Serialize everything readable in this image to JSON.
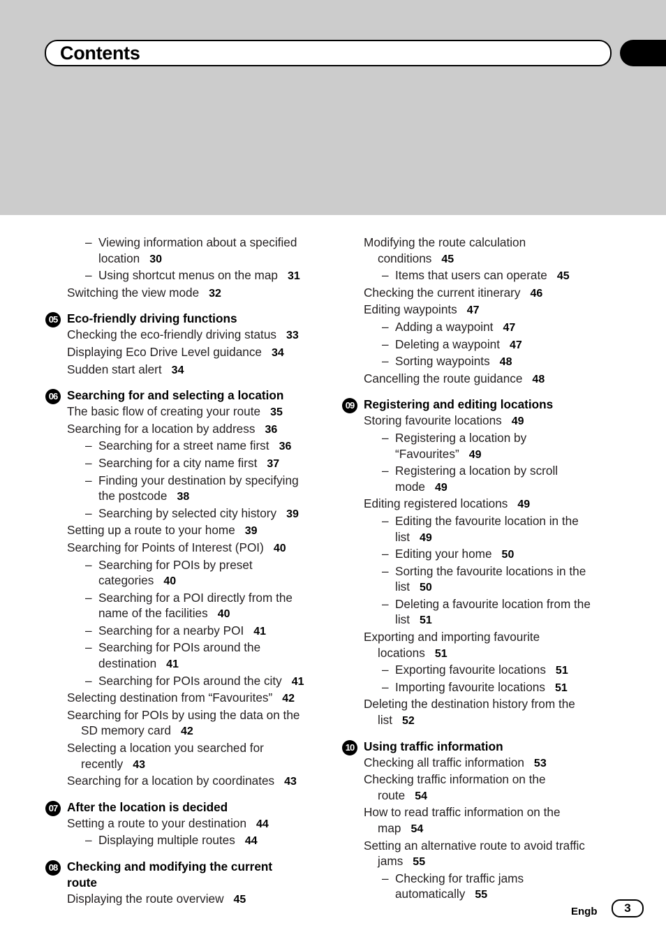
{
  "header": {
    "title": "Contents"
  },
  "left_column": {
    "pre_entries": [
      {
        "level": 2,
        "text": "Viewing information about a specified location",
        "lines": [
          "Viewing information about a specified",
          "location"
        ],
        "page": "30"
      },
      {
        "level": 2,
        "text": "Using shortcut menus on the map",
        "lines": [
          "Using shortcut menus on the map"
        ],
        "page": "31"
      },
      {
        "level": 1,
        "text": "Switching the view mode",
        "lines": [
          "Switching the view mode"
        ],
        "page": "32"
      }
    ],
    "sections": [
      {
        "number": "05",
        "title": "Eco-friendly driving functions",
        "title_lines": [
          "Eco-friendly driving functions"
        ],
        "entries": [
          {
            "level": 1,
            "lines": [
              "Checking the eco-friendly driving status"
            ],
            "page": "33"
          },
          {
            "level": 1,
            "lines": [
              "Displaying Eco Drive Level guidance"
            ],
            "page": "34"
          },
          {
            "level": 1,
            "lines": [
              "Sudden start alert"
            ],
            "page": "34"
          }
        ]
      },
      {
        "number": "06",
        "title": "Searching for and selecting a location",
        "title_lines": [
          "Searching for and selecting a location"
        ],
        "entries": [
          {
            "level": 1,
            "lines": [
              "The basic flow of creating your route"
            ],
            "page": "35"
          },
          {
            "level": 1,
            "lines": [
              "Searching for a location by address"
            ],
            "page": "36"
          },
          {
            "level": 2,
            "lines": [
              "Searching for a street name first"
            ],
            "page": "36"
          },
          {
            "level": 2,
            "lines": [
              "Searching for a city name first"
            ],
            "page": "37"
          },
          {
            "level": 2,
            "lines": [
              "Finding your destination by specifying",
              "the postcode"
            ],
            "page": "38"
          },
          {
            "level": 2,
            "lines": [
              "Searching by selected city history"
            ],
            "page": "39"
          },
          {
            "level": 1,
            "lines": [
              "Setting up a route to your home"
            ],
            "page": "39"
          },
          {
            "level": 1,
            "lines": [
              "Searching for Points of Interest (POI)"
            ],
            "page": "40"
          },
          {
            "level": 2,
            "lines": [
              "Searching for POIs by preset",
              "categories"
            ],
            "page": "40"
          },
          {
            "level": 2,
            "lines": [
              "Searching for a POI directly from the",
              "name of the facilities"
            ],
            "page": "40"
          },
          {
            "level": 2,
            "lines": [
              "Searching for a nearby POI"
            ],
            "page": "41"
          },
          {
            "level": 2,
            "lines": [
              "Searching for POIs around the",
              "destination"
            ],
            "page": "41"
          },
          {
            "level": 2,
            "lines": [
              "Searching for POIs around the city"
            ],
            "page": "41"
          },
          {
            "level": 1,
            "lines": [
              "Selecting destination from “Favourites”"
            ],
            "page": "42"
          },
          {
            "level": 1,
            "lines": [
              "Searching for POIs by using the data on the",
              "SD memory card"
            ],
            "page": "42"
          },
          {
            "level": 1,
            "lines": [
              "Selecting a location you searched for",
              "recently"
            ],
            "page": "43"
          },
          {
            "level": 1,
            "lines": [
              "Searching for a location by coordinates"
            ],
            "page": "43"
          }
        ]
      },
      {
        "number": "07",
        "title": "After the location is decided",
        "title_lines": [
          "After the location is decided"
        ],
        "entries": [
          {
            "level": 1,
            "lines": [
              "Setting a route to your destination"
            ],
            "page": "44"
          },
          {
            "level": 2,
            "lines": [
              "Displaying multiple routes"
            ],
            "page": "44"
          }
        ]
      },
      {
        "number": "08",
        "title": "Checking and modifying the current route",
        "title_lines": [
          "Checking and modifying the current",
          "route"
        ],
        "entries": [
          {
            "level": 1,
            "lines": [
              "Displaying the route overview"
            ],
            "page": "45"
          }
        ]
      }
    ]
  },
  "right_column": {
    "pre_entries": [
      {
        "level": 1,
        "lines": [
          "Modifying the route calculation",
          "conditions"
        ],
        "page": "45"
      },
      {
        "level": 2,
        "lines": [
          "Items that users can operate"
        ],
        "page": "45"
      },
      {
        "level": 1,
        "lines": [
          "Checking the current itinerary"
        ],
        "page": "46"
      },
      {
        "level": 1,
        "lines": [
          "Editing waypoints"
        ],
        "page": "47"
      },
      {
        "level": 2,
        "lines": [
          "Adding a waypoint"
        ],
        "page": "47"
      },
      {
        "level": 2,
        "lines": [
          "Deleting a waypoint"
        ],
        "page": "47"
      },
      {
        "level": 2,
        "lines": [
          "Sorting waypoints"
        ],
        "page": "48"
      },
      {
        "level": 1,
        "lines": [
          "Cancelling the route guidance"
        ],
        "page": "48"
      }
    ],
    "sections": [
      {
        "number": "09",
        "title": "Registering and editing locations",
        "title_lines": [
          "Registering and editing locations"
        ],
        "entries": [
          {
            "level": 1,
            "lines": [
              "Storing favourite locations"
            ],
            "page": "49"
          },
          {
            "level": 2,
            "lines": [
              "Registering a location by",
              "“Favourites”"
            ],
            "page": "49"
          },
          {
            "level": 2,
            "lines": [
              "Registering a location by scroll",
              "mode"
            ],
            "page": "49"
          },
          {
            "level": 1,
            "lines": [
              "Editing registered locations"
            ],
            "page": "49"
          },
          {
            "level": 2,
            "lines": [
              "Editing the favourite location in the",
              "list"
            ],
            "page": "49"
          },
          {
            "level": 2,
            "lines": [
              "Editing your home"
            ],
            "page": "50"
          },
          {
            "level": 2,
            "lines": [
              "Sorting the favourite locations in the",
              "list"
            ],
            "page": "50"
          },
          {
            "level": 2,
            "lines": [
              "Deleting a favourite location from the",
              "list"
            ],
            "page": "51"
          },
          {
            "level": 1,
            "lines": [
              "Exporting and importing favourite",
              "locations"
            ],
            "page": "51"
          },
          {
            "level": 2,
            "lines": [
              "Exporting favourite locations"
            ],
            "page": "51"
          },
          {
            "level": 2,
            "lines": [
              "Importing favourite locations"
            ],
            "page": "51"
          },
          {
            "level": 1,
            "lines": [
              "Deleting the destination history from the",
              "list"
            ],
            "page": "52"
          }
        ]
      },
      {
        "number": "10",
        "title": "Using traffic information",
        "title_lines": [
          "Using traffic information"
        ],
        "entries": [
          {
            "level": 1,
            "lines": [
              "Checking all traffic information"
            ],
            "page": "53"
          },
          {
            "level": 1,
            "lines": [
              "Checking traffic information on the",
              "route"
            ],
            "page": "54"
          },
          {
            "level": 1,
            "lines": [
              "How to read traffic information on the",
              "map"
            ],
            "page": "54"
          },
          {
            "level": 1,
            "lines": [
              "Setting an alternative route to avoid traffic",
              "jams"
            ],
            "page": "55"
          },
          {
            "level": 2,
            "lines": [
              "Checking for traffic jams",
              "automatically"
            ],
            "page": "55"
          }
        ]
      }
    ]
  },
  "footer": {
    "language": "Engb",
    "page_number": "3"
  },
  "colors": {
    "band": "#cccccc",
    "text": "#231f20",
    "badge": "#000000"
  }
}
